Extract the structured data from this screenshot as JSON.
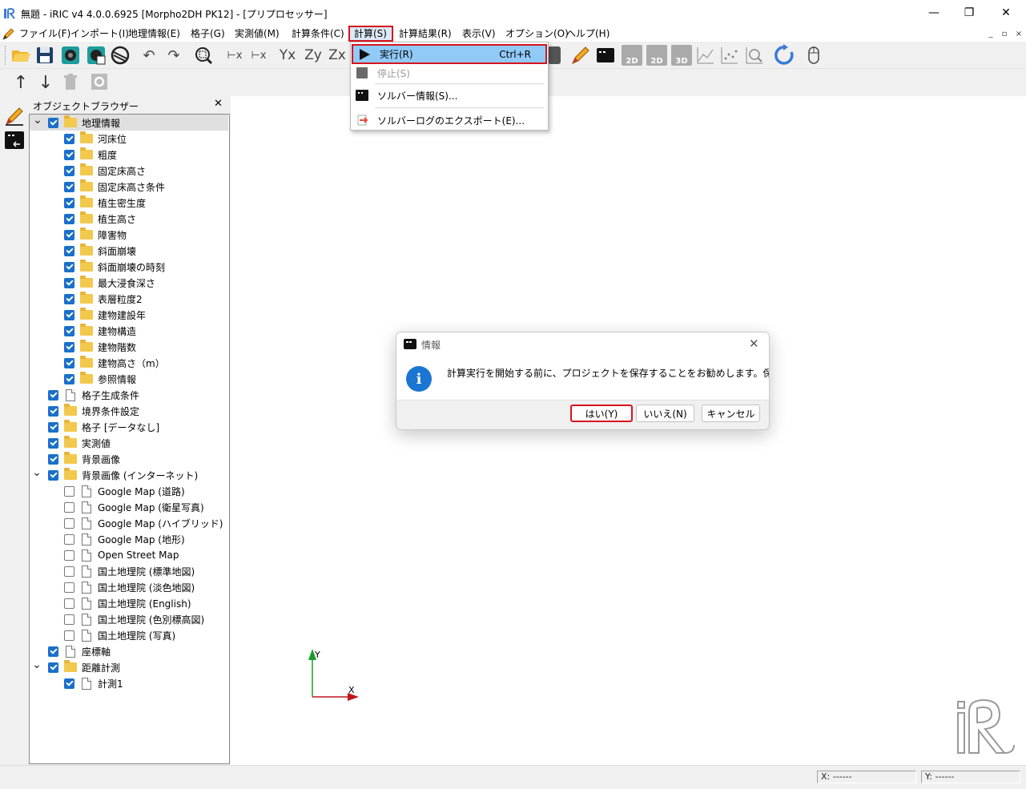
{
  "window": {
    "title": "無題 - iRIC v4 4.0.0.6925 [Morpho2DH PK12] - [プリプロセッサー]",
    "minimize": "—",
    "maximize": "❐",
    "close": "✕"
  },
  "menubar": {
    "items": [
      {
        "label": "ファイル(F)"
      },
      {
        "label": "インポート(I)"
      },
      {
        "label": "地理情報(E)"
      },
      {
        "label": "格子(G)"
      },
      {
        "label": "実測値(M)"
      },
      {
        "label": "計算条件(C)"
      },
      {
        "label": "計算(S)"
      },
      {
        "label": "計算結果(R)"
      },
      {
        "label": "表示(V)"
      },
      {
        "label": "オプション(O)"
      },
      {
        "label": "ヘルプ(H)"
      }
    ],
    "mdi_buttons": [
      "_",
      "▫",
      "×"
    ]
  },
  "toolbar": {
    "axis_labels": [
      "Yx",
      "Zy",
      "Zx"
    ],
    "view_labels": [
      "2D",
      "2D",
      "3D"
    ]
  },
  "calc_menu": {
    "items": [
      {
        "label": "実行(R)",
        "shortcut": "Ctrl+R",
        "icon": "play-icon",
        "enabled": true,
        "highlighted": true
      },
      {
        "label": "停止(S)",
        "shortcut": "",
        "icon": "stop-icon",
        "enabled": false
      },
      {
        "label": "ソルバー情報(S)...",
        "shortcut": "",
        "icon": "console-icon",
        "enabled": true
      },
      {
        "label": "ソルバーログのエクスポート(E)...",
        "shortcut": "",
        "icon": "export-icon",
        "enabled": true
      }
    ]
  },
  "object_browser": {
    "title": "オブジェクトブラウザー",
    "close": "✕",
    "tree": [
      {
        "label": "地理情報",
        "level": 0,
        "icon": "folder",
        "checked": true,
        "expander": "open",
        "selected": true
      },
      {
        "label": "河床位",
        "level": 1,
        "icon": "folder",
        "checked": true
      },
      {
        "label": "粗度",
        "level": 1,
        "icon": "folder",
        "checked": true
      },
      {
        "label": "固定床高さ",
        "level": 1,
        "icon": "folder",
        "checked": true
      },
      {
        "label": "固定床高さ条件",
        "level": 1,
        "icon": "folder",
        "checked": true
      },
      {
        "label": "植生密生度",
        "level": 1,
        "icon": "folder",
        "checked": true
      },
      {
        "label": "植生高さ",
        "level": 1,
        "icon": "folder",
        "checked": true
      },
      {
        "label": "障害物",
        "level": 1,
        "icon": "folder",
        "checked": true
      },
      {
        "label": "斜面崩壊",
        "level": 1,
        "icon": "folder",
        "checked": true
      },
      {
        "label": "斜面崩壊の時刻",
        "level": 1,
        "icon": "folder",
        "checked": true
      },
      {
        "label": "最大浸食深さ",
        "level": 1,
        "icon": "folder",
        "checked": true
      },
      {
        "label": "表層粒度2",
        "level": 1,
        "icon": "folder",
        "checked": true
      },
      {
        "label": "建物建設年",
        "level": 1,
        "icon": "folder",
        "checked": true
      },
      {
        "label": "建物構造",
        "level": 1,
        "icon": "folder",
        "checked": true
      },
      {
        "label": "建物階数",
        "level": 1,
        "icon": "folder",
        "checked": true
      },
      {
        "label": "建物高さ（m）",
        "level": 1,
        "icon": "folder",
        "checked": true
      },
      {
        "label": "参照情報",
        "level": 1,
        "icon": "folder",
        "checked": true
      },
      {
        "label": "格子生成条件",
        "level": 0,
        "icon": "doc",
        "checked": true
      },
      {
        "label": "境界条件設定",
        "level": 0,
        "icon": "folder",
        "checked": true
      },
      {
        "label": "格子 [データなし]",
        "level": 0,
        "icon": "folder",
        "checked": true
      },
      {
        "label": "実測値",
        "level": 0,
        "icon": "folder",
        "checked": true
      },
      {
        "label": "背景画像",
        "level": 0,
        "icon": "folder",
        "checked": true
      },
      {
        "label": "背景画像 (インターネット)",
        "level": 0,
        "icon": "folder",
        "checked": true,
        "expander": "open"
      },
      {
        "label": "Google Map (道路)",
        "level": 1,
        "icon": "doc",
        "checked": false
      },
      {
        "label": "Google Map (衛星写真)",
        "level": 1,
        "icon": "doc",
        "checked": false
      },
      {
        "label": "Google Map (ハイブリッド)",
        "level": 1,
        "icon": "doc",
        "checked": false
      },
      {
        "label": "Google Map (地形)",
        "level": 1,
        "icon": "doc",
        "checked": false
      },
      {
        "label": "Open Street Map",
        "level": 1,
        "icon": "doc",
        "checked": false
      },
      {
        "label": "国土地理院 (標準地図)",
        "level": 1,
        "icon": "doc",
        "checked": false
      },
      {
        "label": "国土地理院 (淡色地図)",
        "level": 1,
        "icon": "doc",
        "checked": false
      },
      {
        "label": "国土地理院 (English)",
        "level": 1,
        "icon": "doc",
        "checked": false
      },
      {
        "label": "国土地理院 (色別標高図)",
        "level": 1,
        "icon": "doc",
        "checked": false
      },
      {
        "label": "国土地理院 (写真)",
        "level": 1,
        "icon": "doc",
        "checked": false
      },
      {
        "label": "座標軸",
        "level": 0,
        "icon": "doc",
        "checked": true
      },
      {
        "label": "距離計測",
        "level": 0,
        "icon": "folder",
        "checked": true,
        "expander": "open"
      },
      {
        "label": "計測1",
        "level": 1,
        "icon": "doc",
        "checked": true
      }
    ]
  },
  "dialog": {
    "title": "情報",
    "close": "✕",
    "icon": "i",
    "message": "計算実行を開始する前に、プロジェクトを保存することをお勧めします。保存しますか?",
    "buttons": {
      "yes": "はい(Y)",
      "no": "いいえ(N)",
      "cancel": "キャンセル"
    }
  },
  "axes": {
    "x_label": "X",
    "y_label": "Y",
    "x_color": "#c0171d",
    "y_color": "#1a9c2a"
  },
  "status": {
    "x": "X: ------",
    "y": "Y: ------"
  },
  "colors": {
    "highlight_border": "#d8141d",
    "menu_highlight": "#91c9f7",
    "info_blue": "#1a76d2",
    "checkbox_blue": "#1a6fc9"
  }
}
